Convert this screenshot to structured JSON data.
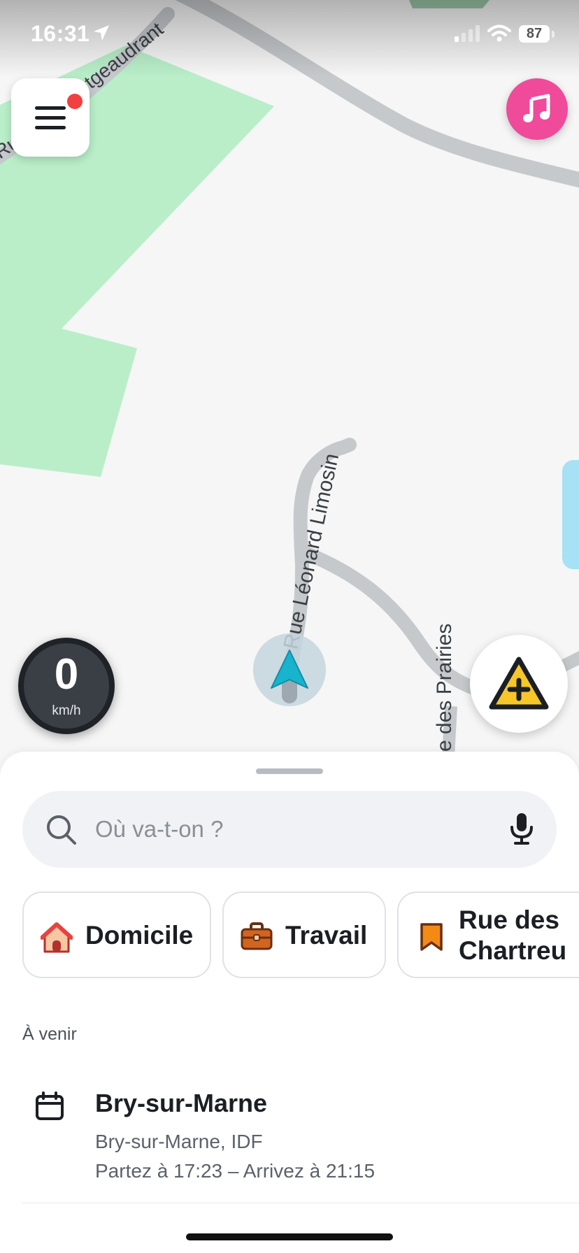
{
  "status_bar": {
    "time": "16:31",
    "battery": "87"
  },
  "map": {
    "street_labels": [
      "Rue",
      "tgeaudrant",
      "Rue Léonard Limosin",
      "e des Prairies"
    ]
  },
  "speedometer": {
    "value": "0",
    "unit": "km/h"
  },
  "search": {
    "placeholder": "Où va-t-on ?"
  },
  "shortcuts": [
    {
      "label": "Domicile",
      "icon": "home-icon"
    },
    {
      "label": "Travail",
      "icon": "briefcase-icon"
    },
    {
      "label_line1": "Rue des",
      "label_line2": "Chartreu",
      "icon": "bookmark-icon"
    }
  ],
  "upcoming": {
    "section_title": "À venir",
    "event": {
      "title": "Bry-sur-Marne",
      "subtitle": "Bry-sur-Marne, IDF",
      "time": "Partez à 17:23 – Arrivez à 21:15"
    }
  },
  "colors": {
    "park": "#b9eec9",
    "road": "#c6c9cc",
    "water": "#a6e1f5",
    "accent_music": "#f04a9b",
    "report_yellow": "#f7c628",
    "nav_arrow": "#18b3cc",
    "notification_dot": "#f1403f"
  }
}
